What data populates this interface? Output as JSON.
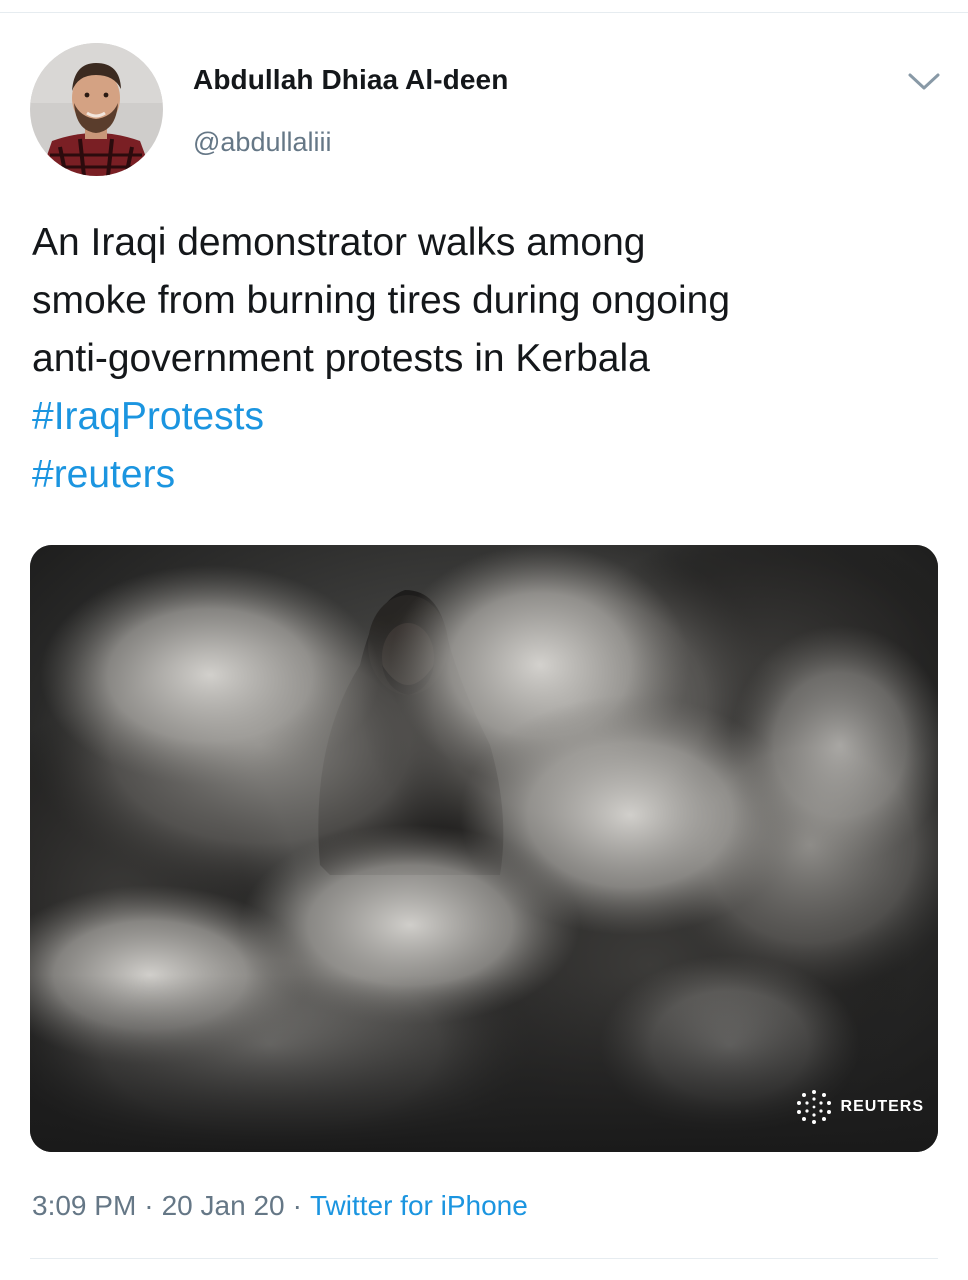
{
  "tweet": {
    "author": {
      "display_name": "Abdullah Dhiaa Al-deen",
      "handle": "@abdullaliii"
    },
    "text_lines": [
      "An Iraqi demonstrator walks among",
      "smoke from burning tires during ongoing",
      "anti-government protests in Kerbala"
    ],
    "hashtags": [
      "#IraqProtests",
      "#reuters"
    ],
    "media": {
      "watermark": "REUTERS"
    },
    "meta": {
      "time": "3:09 PM",
      "date": "20 Jan 20",
      "source": "Twitter for iPhone",
      "separator": "·"
    }
  },
  "icons": {
    "caret": "chevron-down-icon",
    "watermark_logo": "reuters-logo-icon"
  },
  "colors": {
    "text": "#14171a",
    "secondary": "#657786",
    "link": "#1b95e0",
    "divider": "#e6ecf0"
  }
}
